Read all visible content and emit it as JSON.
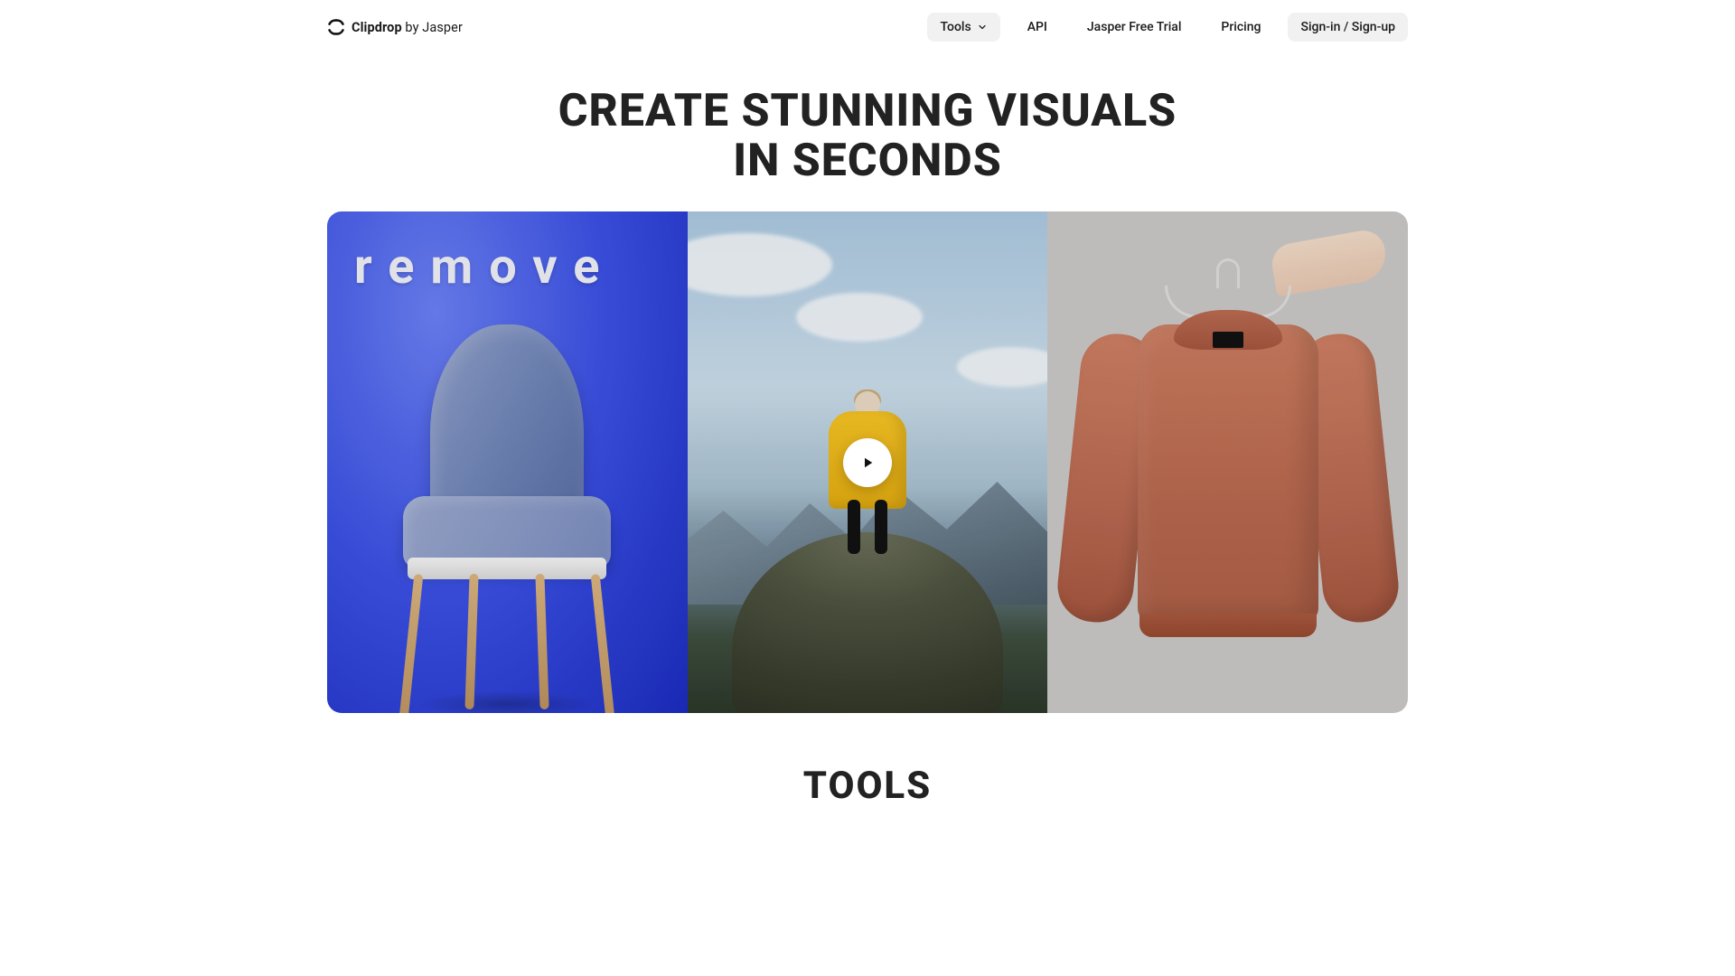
{
  "brand": {
    "name_bold": "Clipdrop",
    "name_rest": " by Jasper"
  },
  "nav": {
    "tools": "Tools",
    "api": "API",
    "trial": "Jasper Free Trial",
    "pricing": "Pricing",
    "signin": "Sign-in / Sign-up"
  },
  "hero": {
    "line1": "CREATE STUNNING VISUALS",
    "line2": "IN SECONDS"
  },
  "video": {
    "overlay_word": "remove"
  },
  "sections": {
    "tools_heading": "TOOLS"
  }
}
